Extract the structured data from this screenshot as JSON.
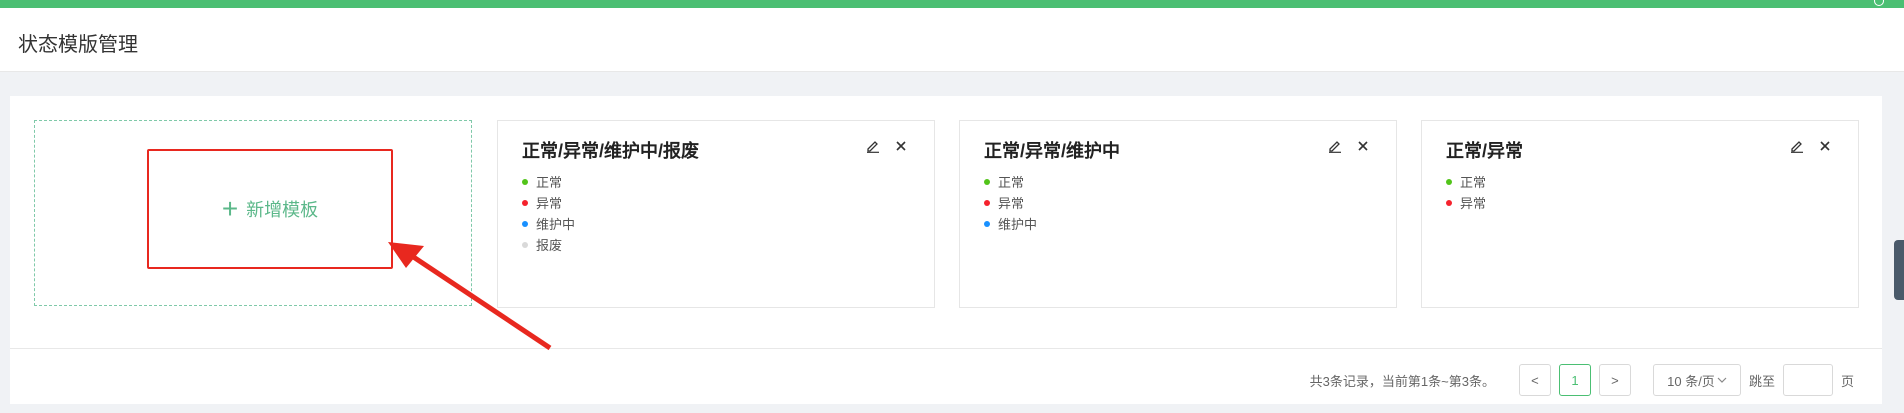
{
  "header": {
    "title": "状态模版管理"
  },
  "add_card": {
    "label": "新增模板"
  },
  "templates": [
    {
      "title": "正常/异常/维护中/报废",
      "statuses": [
        {
          "label": "正常",
          "color": "#52c41a"
        },
        {
          "label": "异常",
          "color": "#f5222d"
        },
        {
          "label": "维护中",
          "color": "#1890ff"
        },
        {
          "label": "报废",
          "color": "#d9d9d9"
        }
      ]
    },
    {
      "title": "正常/异常/维护中",
      "statuses": [
        {
          "label": "正常",
          "color": "#52c41a"
        },
        {
          "label": "异常",
          "color": "#f5222d"
        },
        {
          "label": "维护中",
          "color": "#1890ff"
        }
      ]
    },
    {
      "title": "正常/异常",
      "statuses": [
        {
          "label": "正常",
          "color": "#52c41a"
        },
        {
          "label": "异常",
          "color": "#f5222d"
        }
      ]
    }
  ],
  "pagination": {
    "total_text": "共3条记录，当前第1条~第3条。",
    "prev": "<",
    "current": "1",
    "next": ">",
    "page_size": "10 条/页",
    "jump_label": "跳至",
    "page_unit": "页"
  },
  "colors": {
    "accent": "#4bbf73",
    "highlight": "#e8281f"
  },
  "icons": {
    "edit": "edit-icon",
    "delete": "close-icon",
    "add": "plus-icon"
  }
}
